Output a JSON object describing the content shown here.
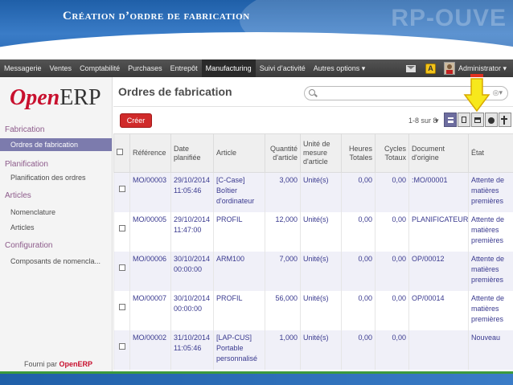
{
  "slide": {
    "title": "Création d’ordre de fabrication",
    "decoration": "RP-OUVE"
  },
  "menubar": {
    "items": [
      "Messagerie",
      "Ventes",
      "Comptabilité",
      "Purchases",
      "Entrepôt",
      "Manufacturing",
      "Suivi d’activité",
      "Autres options ▾"
    ],
    "active": "Manufacturing",
    "alert_label": "A",
    "user": "Administrator ▾"
  },
  "sidebar": {
    "logo_open": "Open",
    "logo_erp": "ERP",
    "sections": [
      {
        "title": "Fabrication",
        "items": [
          "Ordres de fabrication"
        ]
      },
      {
        "title": "Planification",
        "items": [
          "Planification des ordres"
        ]
      },
      {
        "title": "Articles",
        "items": [
          "Nomenclature",
          "Articles"
        ]
      },
      {
        "title": "Configuration",
        "items": [
          "Composants de nomencla..."
        ]
      }
    ],
    "active_item": "Ordres de fabrication",
    "powered_prefix": "Fourni par",
    "powered_brand": "OpenERP"
  },
  "content": {
    "title": "Ordres de fabrication",
    "search_placeholder": "",
    "create_label": "Créer",
    "pager": "1-8 sur 8",
    "pager_caret": "▾",
    "views": [
      "list-view-icon",
      "form-view-icon",
      "calendar-view-icon",
      "graph-view-icon",
      "gantt-view-icon"
    ],
    "active_view": "list-view-icon"
  },
  "table": {
    "headers": [
      "Référence",
      "Date planifiée",
      "Article",
      "Quantité d'article",
      "Unité de mesure d'article",
      "Heures Totales",
      "Cycles Totaux",
      "Document d'origine",
      "État"
    ],
    "rows": [
      [
        "MO/00003",
        "29/10/2014 11:05:46",
        "[C-Case] Boîtier d'ordinateur",
        "3,000",
        "Unité(s)",
        "0,00",
        "0,00",
        ":MO/00001",
        "Attente de matières premières"
      ],
      [
        "MO/00005",
        "29/10/2014 11:47:00",
        "PROFIL",
        "12,000",
        "Unité(s)",
        "0,00",
        "0,00",
        "PLANIFICATEUR",
        "Attente de matières premières"
      ],
      [
        "MO/00006",
        "30/10/2014 00:00:00",
        "ARM100",
        "7,000",
        "Unité(s)",
        "0,00",
        "0,00",
        "OP/00012",
        "Attente de matières premières"
      ],
      [
        "MO/00007",
        "30/10/2014 00:00:00",
        "PROFIL",
        "56,000",
        "Unité(s)",
        "0,00",
        "0,00",
        "OP/00014",
        "Attente de matières premières"
      ],
      [
        "MO/00002",
        "31/10/2014 11:05:46",
        "[LAP-CUS] Portable personnalisé",
        "1,000",
        "Unité(s)",
        "0,00",
        "0,00",
        "",
        "Nouveau"
      ]
    ]
  },
  "colors": {
    "brand_red": "#c8102e",
    "accent_purple": "#7c7bad",
    "link_blue": "#3a3a8f",
    "pointer_yellow": "#f7e81c"
  }
}
